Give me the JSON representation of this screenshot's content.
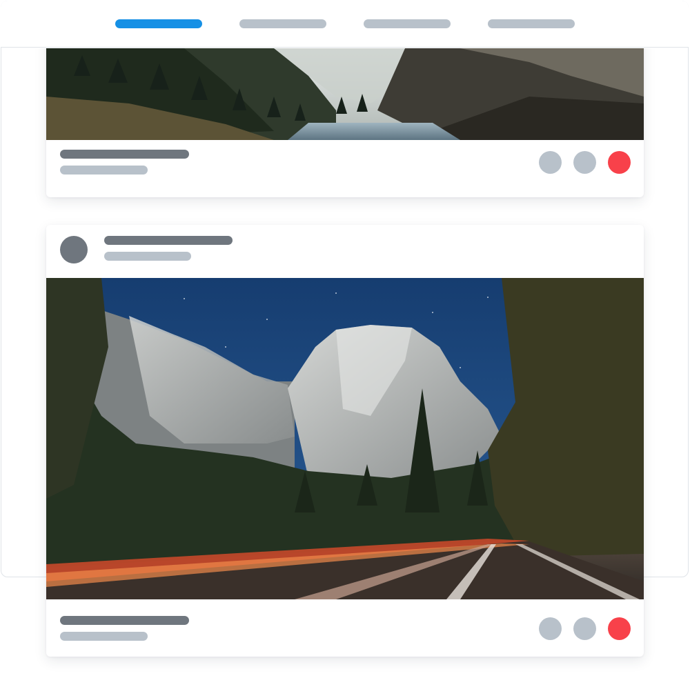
{
  "nav": {
    "tabs": [
      {
        "label": "",
        "active": true
      },
      {
        "label": "",
        "active": false
      },
      {
        "label": "",
        "active": false
      },
      {
        "label": "",
        "active": false
      }
    ]
  },
  "colors": {
    "accent": "#1690e5",
    "placeholder_dark": "#6f767e",
    "placeholder_light": "#b8c1ca",
    "like_red": "#f8414a",
    "border": "#dfe3e8"
  },
  "feed": {
    "posts": [
      {
        "image": "mountain-valley-lake-photo",
        "actions": [
          "grey-action-icon",
          "grey-action-icon",
          "heart-icon"
        ]
      },
      {
        "author_avatar": "avatar",
        "image": "granite-cliff-night-road-photo",
        "actions": [
          "grey-action-icon",
          "grey-action-icon",
          "heart-icon"
        ]
      }
    ]
  }
}
